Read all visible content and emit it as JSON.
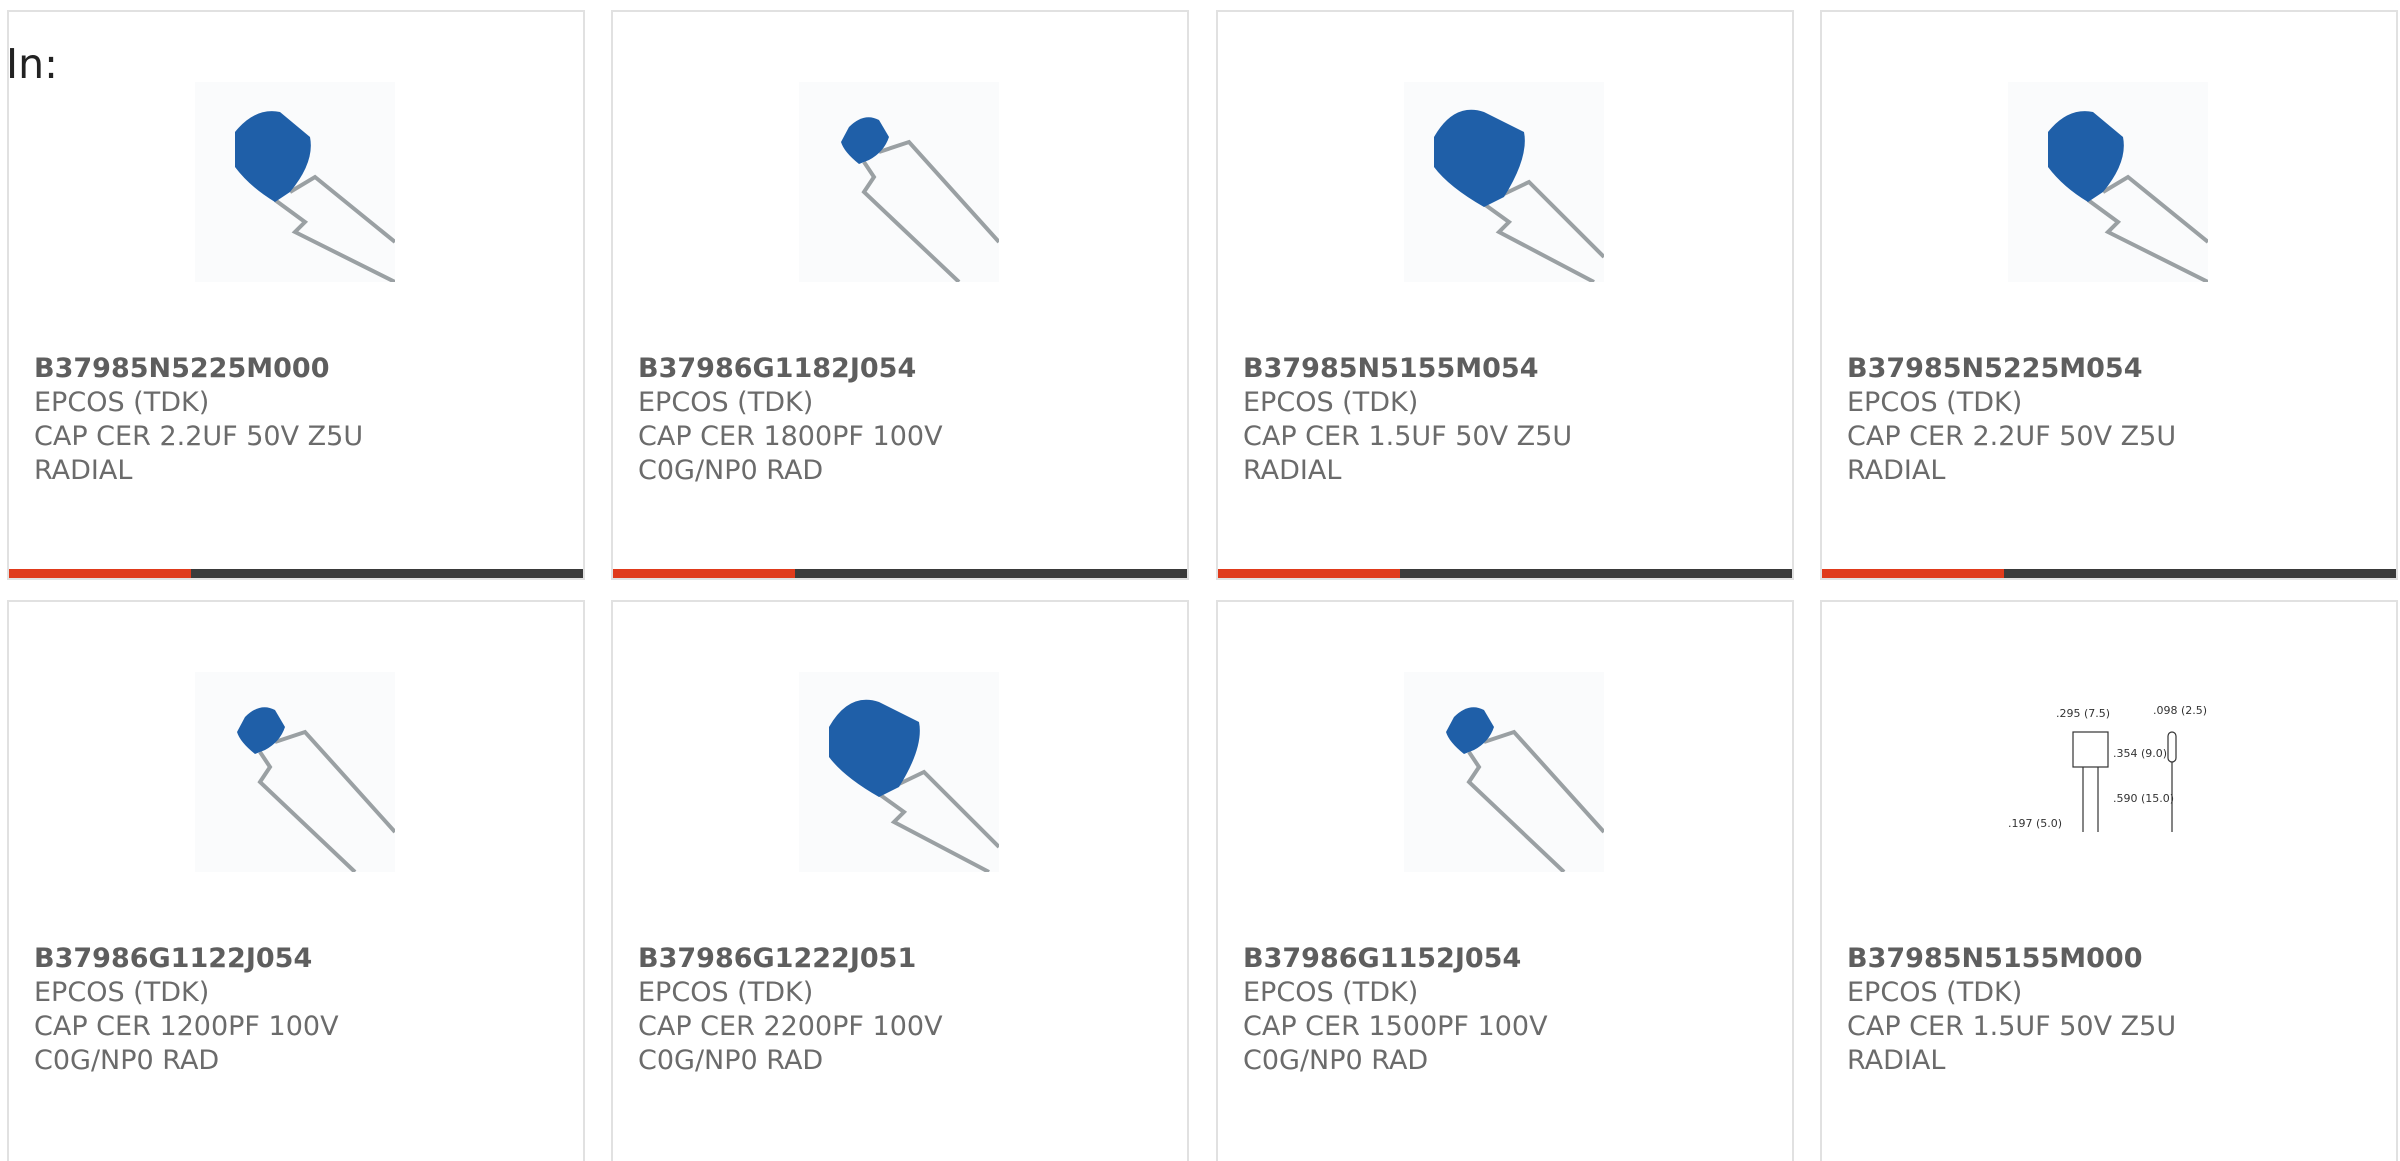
{
  "header": {
    "label": "In:"
  },
  "colors": {
    "accent": "#e03a1b",
    "bar": "#3a3a3a",
    "capacitor": "#1f5fa8",
    "text": "#6b6b6b",
    "border": "#e1e1e1"
  },
  "products": [
    {
      "part": "B37985N5225M000",
      "manufacturer": "EPCOS (TDK)",
      "description": "CAP CER 2.2UF 50V Z5U RADIAL",
      "image": "capacitor-photo-icon",
      "show_bar": true
    },
    {
      "part": "B37986G1182J054",
      "manufacturer": "EPCOS (TDK)",
      "description": "CAP CER 1800PF 100V C0G/NP0 RAD",
      "image": "capacitor-photo-icon",
      "show_bar": true
    },
    {
      "part": "B37985N5155M054",
      "manufacturer": "EPCOS (TDK)",
      "description": "CAP CER 1.5UF 50V Z5U RADIAL",
      "image": "capacitor-photo-icon",
      "show_bar": true
    },
    {
      "part": "B37985N5225M054",
      "manufacturer": "EPCOS (TDK)",
      "description": "CAP CER 2.2UF 50V Z5U RADIAL",
      "image": "capacitor-photo-icon",
      "show_bar": true
    },
    {
      "part": "B37986G1122J054",
      "manufacturer": "EPCOS (TDK)",
      "description": "CAP CER 1200PF 100V C0G/NP0 RAD",
      "image": "capacitor-photo-icon",
      "show_bar": false
    },
    {
      "part": "B37986G1222J051",
      "manufacturer": "EPCOS (TDK)",
      "description": "CAP CER 2200PF 100V C0G/NP0 RAD",
      "image": "capacitor-photo-icon",
      "show_bar": false
    },
    {
      "part": "B37986G1152J054",
      "manufacturer": "EPCOS (TDK)",
      "description": "CAP CER 1500PF 100V C0G/NP0 RAD",
      "image": "capacitor-photo-icon",
      "show_bar": false
    },
    {
      "part": "B37985N5155M000",
      "manufacturer": "EPCOS (TDK)",
      "description": "CAP CER 1.5UF 50V Z5U RADIAL",
      "image": "dimension-drawing-icon",
      "show_bar": false
    }
  ],
  "drawing_labels": {
    "width": ".295 (7.5)",
    "thickness": ".098 (2.5)",
    "height": ".354 (9.0)",
    "lead": ".590 (15.0)",
    "pitch": ".197 (5.0)"
  }
}
